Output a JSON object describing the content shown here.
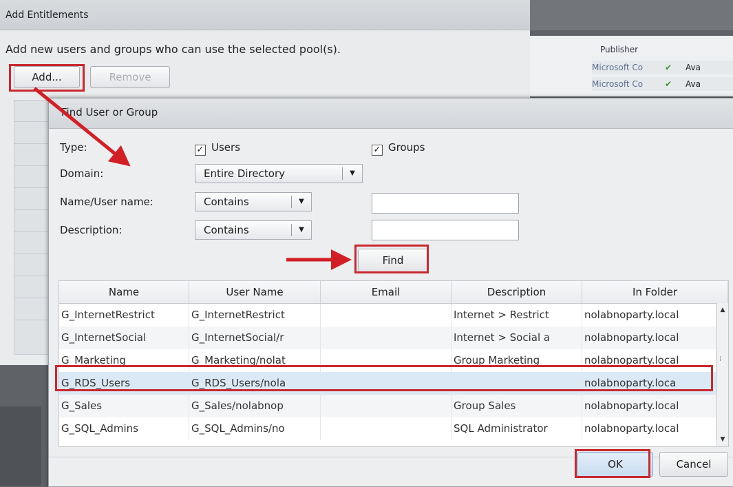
{
  "background": {
    "column_header": "Publisher",
    "rows": [
      {
        "publisher": "Microsoft Co",
        "check": "✔",
        "status": "Ava"
      },
      {
        "publisher": "Microsoft Co",
        "check": "✔",
        "status": "Ava"
      }
    ]
  },
  "outer_dialog": {
    "title": "Add Entitlements",
    "description": "Add new users and groups who can use the selected pool(s).",
    "add_label": "Add...",
    "remove_label": "Remove"
  },
  "inner_dialog": {
    "title": "Find User or Group",
    "type_label": "Type:",
    "users_label": "Users",
    "groups_label": "Groups",
    "users_checked": true,
    "groups_checked": true,
    "domain_label": "Domain:",
    "domain_value": "Entire Directory",
    "name_label": "Name/User name:",
    "name_match": "Contains",
    "name_value": "",
    "description_label": "Description:",
    "description_match": "Contains",
    "description_value": "",
    "find_label": "Find",
    "ok_label": "OK",
    "cancel_label": "Cancel",
    "columns": [
      "Name",
      "User Name",
      "Email",
      "Description",
      "In Folder"
    ],
    "rows": [
      {
        "name": "G_InternetRestrict",
        "user": "G_InternetRestrict",
        "email": "",
        "desc": "Internet > Restrict",
        "folder": "nolabnoparty.local"
      },
      {
        "name": "G_InternetSocial",
        "user": "G_InternetSocial/r",
        "email": "",
        "desc": "Internet > Social a",
        "folder": "nolabnoparty.local"
      },
      {
        "name": "G_Marketing",
        "user": "G_Marketing/nolat",
        "email": "",
        "desc": "Group Marketing",
        "folder": "nolabnoparty.local"
      },
      {
        "name": "G_RDS_Users",
        "user": "G_RDS_Users/nola",
        "email": "",
        "desc": "",
        "folder": "nolabnoparty.loca"
      },
      {
        "name": "G_Sales",
        "user": "G_Sales/nolabnop",
        "email": "",
        "desc": "Group Sales",
        "folder": "nolabnoparty.local"
      },
      {
        "name": "G_SQL_Admins",
        "user": "G_SQL_Admins/no",
        "email": "",
        "desc": "SQL Administrator",
        "folder": "nolabnoparty.local"
      }
    ],
    "selected_row": 3
  },
  "icons": {
    "check": "check-icon",
    "dropdown": "chevron-down-icon",
    "scroll_up": "arrow-up-icon",
    "scroll_down": "arrow-down-icon"
  },
  "colors": {
    "highlight": "#c8282e",
    "selected_row": "#dbe9f6"
  }
}
